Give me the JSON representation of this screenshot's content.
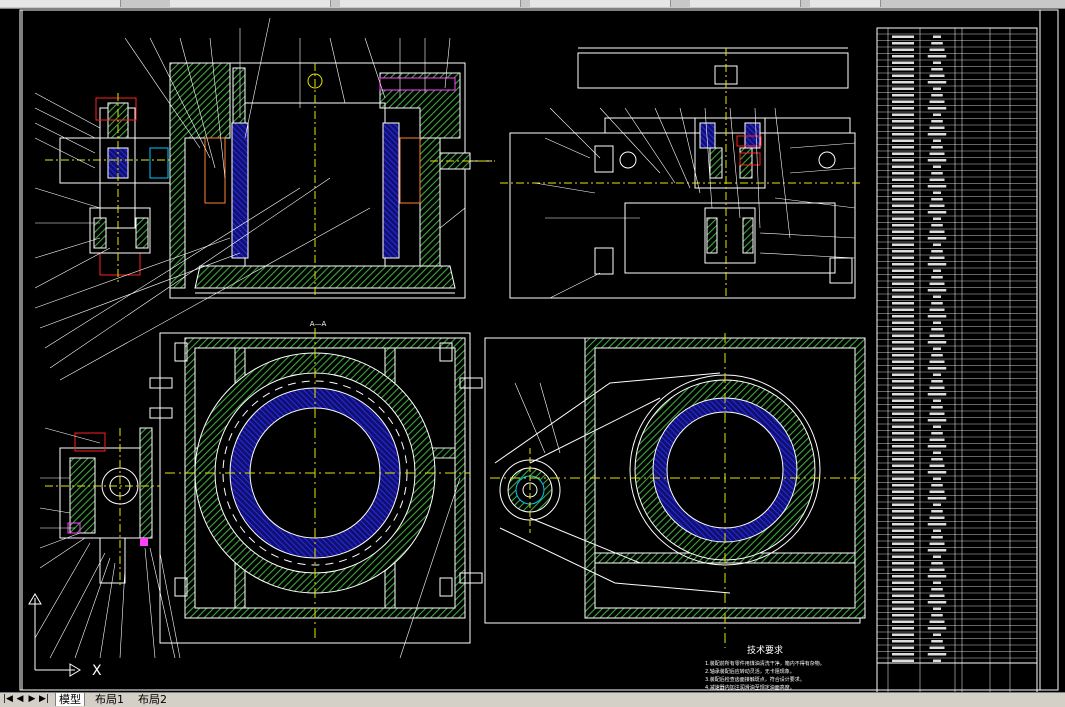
{
  "title_block": {
    "notes_title": "技术要求",
    "notes": [
      "1.装配前所有零件用煤油清洗干净，箱内不得有杂物。",
      "2.轴承装配后应转动灵活，无卡阻现象。",
      "3.装配后检查齿面接触斑点，符合设计要求。",
      "4.减速器内加注润滑油至规定油面高度。"
    ]
  },
  "section_label": "A—A",
  "axis": {
    "x_label": "X",
    "y_label": "Y"
  },
  "layout_tabs": [
    {
      "label": "模型",
      "active": true
    },
    {
      "label": "布局1",
      "active": false
    },
    {
      "label": "布局2",
      "active": false
    }
  ],
  "nav_buttons": [
    "|◀",
    "◀",
    "▶",
    "▶|"
  ],
  "colors": {
    "background": "#000000",
    "outline": "#ffffff",
    "hatch_green": "#3fa63f",
    "hatch_blue": "#1e1ec8",
    "annotation_red": "#ff2020",
    "centerline_yellow": "#e6e600",
    "part_magenta": "#ff40ff",
    "part_cyan": "#00c8ff"
  }
}
